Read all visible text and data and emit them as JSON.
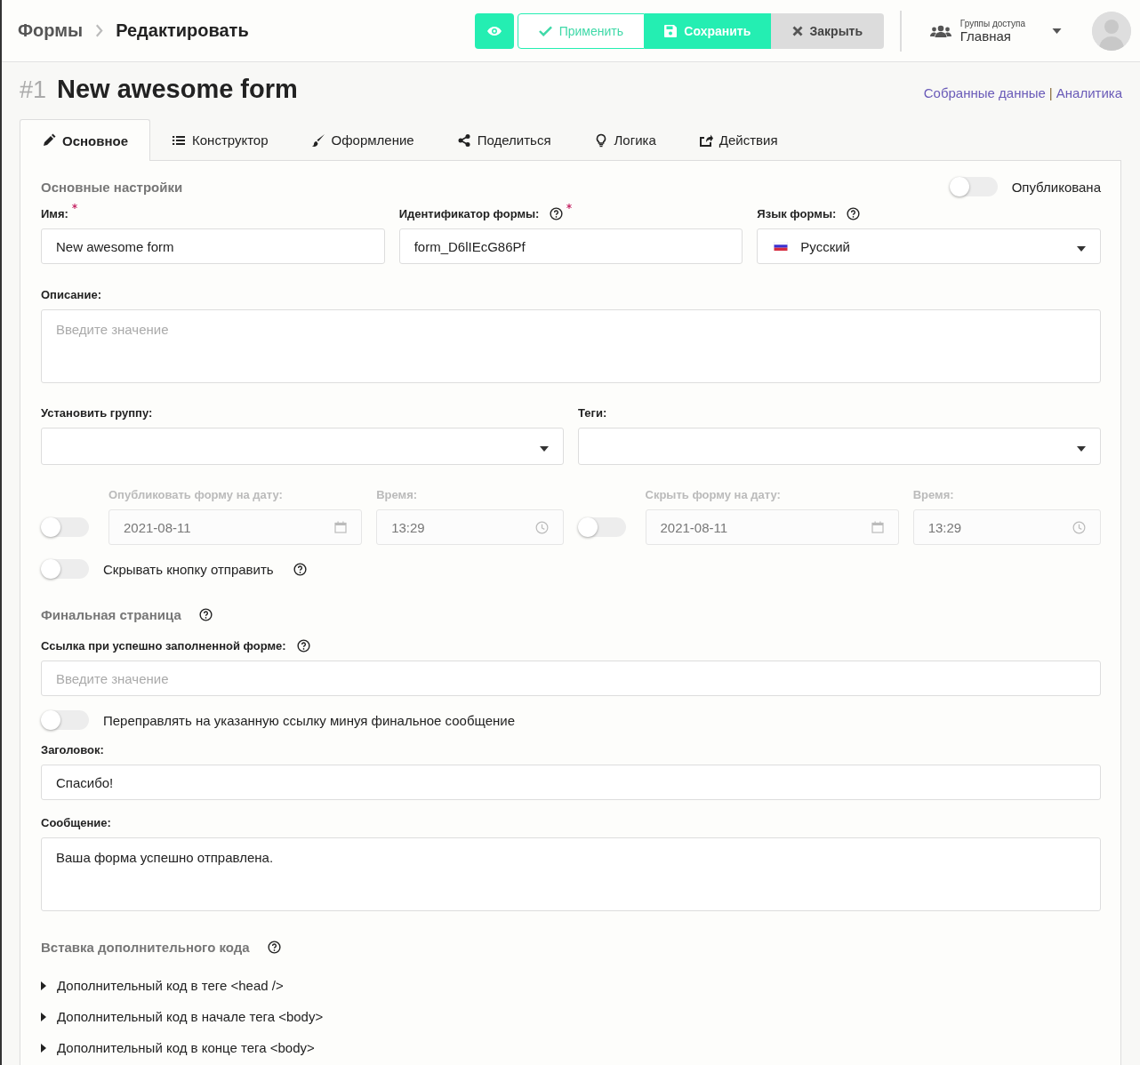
{
  "breadcrumb": [
    {
      "label": "Формы"
    },
    {
      "label": "Редактировать"
    }
  ],
  "toolbar": [
    {
      "kind": "preview"
    },
    {
      "kind": "apply",
      "label": "Применить"
    },
    {
      "kind": "save",
      "label": "Сохранить"
    },
    {
      "kind": "close",
      "label": "Закрыть"
    }
  ],
  "access_group": {
    "caption": "Группы доступа",
    "value": "Главная"
  },
  "form_title": {
    "number": "#1",
    "name": "New awesome form"
  },
  "links": {
    "items": [
      "Собранные данные",
      "Аналитика"
    ],
    "separator": "|"
  },
  "tabs": [
    {
      "label": "Основное",
      "selected": true
    },
    {
      "label": "Конструктор",
      "selected": false
    },
    {
      "label": "Оформление",
      "selected": false
    },
    {
      "label": "Поделиться",
      "selected": false
    },
    {
      "label": "Логика",
      "selected": false
    },
    {
      "label": "Действия",
      "selected": false
    }
  ],
  "main_section": {
    "title": "Основные настройки",
    "published": {
      "label": "Опубликована",
      "on": false
    }
  },
  "name_field": {
    "label": "Имя:",
    "required": true,
    "value": "New awesome form"
  },
  "id_field": {
    "label": "Идентификатор формы:",
    "required": true,
    "value": "form_D6lIEcG86Pf"
  },
  "language_field": {
    "label": "Язык формы:",
    "value": "Русский"
  },
  "description_field": {
    "label": "Описание:",
    "placeholder": "Введите значение"
  },
  "group_field": {
    "label": "Установить группу:"
  },
  "tags_field": {
    "label": "Теги:"
  },
  "schedule": [
    {
      "on": false,
      "disabled": true,
      "date_label": "Опубликовать форму на дату:",
      "date": "2021-08-11",
      "time_label": "Время:",
      "time": "13:29"
    },
    {
      "on": false,
      "disabled": true,
      "date_label": "Скрыть форму на дату:",
      "date": "2021-08-11",
      "time_label": "Время:",
      "time": "13:29"
    }
  ],
  "hide_submit": {
    "label": "Скрывать кнопку отправить",
    "on": false
  },
  "final_section": {
    "title": "Финальная страница"
  },
  "link_field": {
    "label": "Ссылка при успешно заполненной форме:",
    "placeholder": "Введите значение"
  },
  "redirect": {
    "label": "Переправлять на указанную ссылку минуя финальное сообщение",
    "on": false
  },
  "heading_field": {
    "label": "Заголовок:",
    "value": "Спасибо!"
  },
  "message_field": {
    "label": "Сообщение:",
    "value": "Ваша форма успешно отправлена."
  },
  "code_section": {
    "title": "Вставка дополнительного кода"
  },
  "code_items": [
    {
      "label": "Дополнительный код в теге <head />",
      "expanded": false
    },
    {
      "label": "Дополнительный код в начале тега <body>",
      "expanded": false
    },
    {
      "label": "Дополнительный код в конце тега <body>",
      "expanded": false
    }
  ]
}
